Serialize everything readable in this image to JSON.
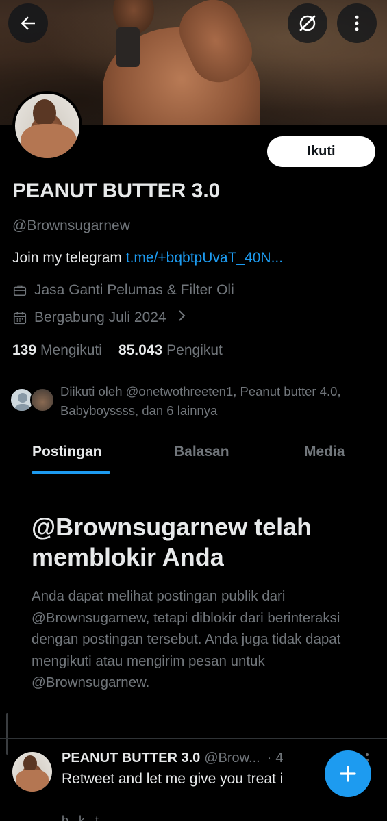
{
  "profile": {
    "follow_label": "Ikuti",
    "name": "PEANUT BUTTER 3.0",
    "handle": "@Brownsugarnew",
    "bio_text": "Join my telegram ",
    "bio_link": "t.me/+bqbtpUvaT_40N...",
    "job": "Jasa Ganti Pelumas & Filter Oli",
    "joined": "Bergabung Juli 2024",
    "following_count": "139",
    "following_label": "Mengikuti",
    "followers_count": "85.043",
    "followers_label": "Pengikut",
    "followed_by": "Diikuti oleh @onetwothreeten1, Peanut butter 4.0, Babyboyssss, dan 6 lainnya"
  },
  "tabs": [
    {
      "label": "Postingan",
      "active": true
    },
    {
      "label": "Balasan",
      "active": false
    },
    {
      "label": "Media",
      "active": false
    }
  ],
  "blocked": {
    "title": "@Brownsugarnew telah memblokir Anda",
    "description": "Anda dapat melihat postingan publik dari @Brownsugarnew, tetapi diblokir dari berinteraksi dengan postingan tersebut. Anda juga tidak dapat mengikuti atau mengirim pesan untuk @Brownsugarnew."
  },
  "tweet": {
    "name": "PEANUT BUTTER 3.0",
    "handle": "@Brow...",
    "dot": "·",
    "time": "4",
    "text": "Retweet and let me give you treat i",
    "next_prefix": "b...k...t",
    "next_link": "..."
  },
  "icons": {
    "back": "arrow-left-icon",
    "grok": "grok-icon",
    "more": "more-vertical-icon",
    "job": "briefcase-icon",
    "calendar": "calendar-icon",
    "chevron": "chevron-right-icon",
    "compose": "plus-icon"
  },
  "colors": {
    "accent": "#1d9bf0",
    "background": "#000000",
    "text_primary": "#e7e9ea",
    "text_secondary": "#71767b"
  }
}
